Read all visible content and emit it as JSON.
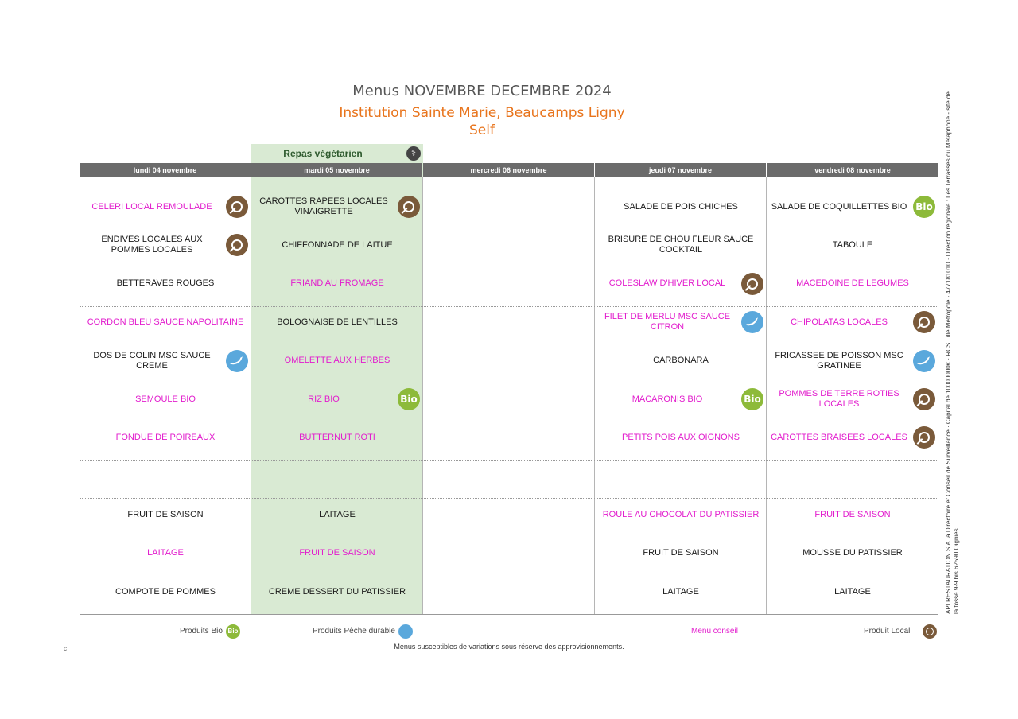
{
  "header": {
    "title": "Menus NOVEMBRE DECEMBRE 2024",
    "subtitle": "Institution Sainte Marie, Beaucamps Ligny",
    "subtitle2": "Self"
  },
  "veg_label": "Repas végétarien",
  "days": [
    "lundi 04 novembre",
    "mardi 05 novembre",
    "mercredi 06 novembre",
    "jeudi 07 novembre",
    "vendredi 08 novembre"
  ],
  "rows": [
    {
      "cells": [
        {
          "text": "CELERI LOCAL REMOULADE",
          "conseil": true,
          "icon": "local"
        },
        {
          "text": "CAROTTES RAPEES LOCALES VINAIGRETTE",
          "conseil": false,
          "icon": "local"
        },
        {
          "text": "",
          "conseil": false,
          "icon": ""
        },
        {
          "text": "SALADE DE POIS CHICHES",
          "conseil": false,
          "icon": ""
        },
        {
          "text": "SALADE DE COQUILLETTES BIO",
          "conseil": false,
          "icon": "bio"
        }
      ]
    },
    {
      "cells": [
        {
          "text": "ENDIVES LOCALES AUX POMMES LOCALES",
          "conseil": false,
          "icon": "local"
        },
        {
          "text": "CHIFFONNADE DE LAITUE",
          "conseil": false,
          "icon": ""
        },
        {
          "text": "",
          "conseil": false,
          "icon": ""
        },
        {
          "text": "BRISURE DE CHOU FLEUR SAUCE COCKTAIL",
          "conseil": false,
          "icon": ""
        },
        {
          "text": "TABOULE",
          "conseil": false,
          "icon": ""
        }
      ]
    },
    {
      "cells": [
        {
          "text": "BETTERAVES ROUGES",
          "conseil": false,
          "icon": ""
        },
        {
          "text": "FRIAND AU FROMAGE",
          "conseil": true,
          "icon": ""
        },
        {
          "text": "",
          "conseil": false,
          "icon": ""
        },
        {
          "text": "COLESLAW D'HIVER LOCAL",
          "conseil": true,
          "icon": "local"
        },
        {
          "text": "MACEDOINE DE LEGUMES",
          "conseil": true,
          "icon": ""
        }
      ]
    },
    {
      "cells": [
        {
          "text": "CORDON BLEU SAUCE NAPOLITAINE",
          "conseil": true,
          "icon": ""
        },
        {
          "text": "BOLOGNAISE DE LENTILLES",
          "conseil": false,
          "icon": ""
        },
        {
          "text": "",
          "conseil": false,
          "icon": ""
        },
        {
          "text": "FILET DE MERLU MSC SAUCE CITRON",
          "conseil": true,
          "icon": "peche"
        },
        {
          "text": "CHIPOLATAS LOCALES",
          "conseil": true,
          "icon": "local"
        }
      ]
    },
    {
      "cells": [
        {
          "text": "DOS DE COLIN MSC SAUCE CREME",
          "conseil": false,
          "icon": "peche"
        },
        {
          "text": "OMELETTE AUX HERBES",
          "conseil": true,
          "icon": ""
        },
        {
          "text": "",
          "conseil": false,
          "icon": ""
        },
        {
          "text": "CARBONARA",
          "conseil": false,
          "icon": ""
        },
        {
          "text": "FRICASSEE DE POISSON MSC GRATINEE",
          "conseil": false,
          "icon": "peche"
        }
      ]
    },
    {
      "cells": [
        {
          "text": "SEMOULE BIO",
          "conseil": true,
          "icon": ""
        },
        {
          "text": "RIZ BIO",
          "conseil": true,
          "icon": "bio"
        },
        {
          "text": "",
          "conseil": false,
          "icon": ""
        },
        {
          "text": "MACARONIS BIO",
          "conseil": true,
          "icon": "bio"
        },
        {
          "text": "POMMES DE TERRE ROTIES LOCALES",
          "conseil": true,
          "icon": "local"
        }
      ]
    },
    {
      "cells": [
        {
          "text": "FONDUE DE POIREAUX",
          "conseil": true,
          "icon": ""
        },
        {
          "text": "BUTTERNUT ROTI",
          "conseil": true,
          "icon": ""
        },
        {
          "text": "",
          "conseil": false,
          "icon": ""
        },
        {
          "text": "PETITS POIS AUX OIGNONS",
          "conseil": true,
          "icon": ""
        },
        {
          "text": "CAROTTES BRAISEES LOCALES",
          "conseil": true,
          "icon": "local"
        }
      ]
    },
    {
      "cells": [
        {
          "text": "",
          "conseil": false,
          "icon": ""
        },
        {
          "text": "",
          "conseil": false,
          "icon": ""
        },
        {
          "text": "",
          "conseil": false,
          "icon": ""
        },
        {
          "text": "",
          "conseil": false,
          "icon": ""
        },
        {
          "text": "",
          "conseil": false,
          "icon": ""
        }
      ]
    },
    {
      "cells": [
        {
          "text": "FRUIT DE SAISON",
          "conseil": false,
          "icon": ""
        },
        {
          "text": "LAITAGE",
          "conseil": false,
          "icon": ""
        },
        {
          "text": "",
          "conseil": false,
          "icon": ""
        },
        {
          "text": "ROULE AU CHOCOLAT DU PATISSIER",
          "conseil": true,
          "icon": ""
        },
        {
          "text": "FRUIT DE SAISON",
          "conseil": true,
          "icon": ""
        }
      ]
    },
    {
      "cells": [
        {
          "text": "LAITAGE",
          "conseil": true,
          "icon": ""
        },
        {
          "text": "FRUIT DE SAISON",
          "conseil": true,
          "icon": ""
        },
        {
          "text": "",
          "conseil": false,
          "icon": ""
        },
        {
          "text": "FRUIT DE SAISON",
          "conseil": false,
          "icon": ""
        },
        {
          "text": "MOUSSE DU PATISSIER",
          "conseil": false,
          "icon": ""
        }
      ]
    },
    {
      "cells": [
        {
          "text": "COMPOTE DE POMMES",
          "conseil": false,
          "icon": ""
        },
        {
          "text": "CREME DESSERT DU PATISSIER",
          "conseil": false,
          "icon": ""
        },
        {
          "text": "",
          "conseil": false,
          "icon": ""
        },
        {
          "text": "LAITAGE",
          "conseil": false,
          "icon": ""
        },
        {
          "text": "LAITAGE",
          "conseil": false,
          "icon": ""
        }
      ]
    }
  ],
  "legend": {
    "bio": "Produits Bio",
    "peche": "Produits Pêche durable",
    "conseil": "Menu conseil",
    "local": "Produit Local"
  },
  "bio_icon_text": "Bio",
  "footnote": "Menus susceptibles de variations sous réserve des approvisionnements.",
  "corner_mark": "c",
  "side_text": "API RESTAURATION S.A. à Directoire et Conseil de Surveillance · Capital de 10000000€ · RCS Lille Métropole - 477181010 · Direction régionale : Les Terrasses du Métaphone - site de la fosse 9-9 bis 62590 Oignies"
}
